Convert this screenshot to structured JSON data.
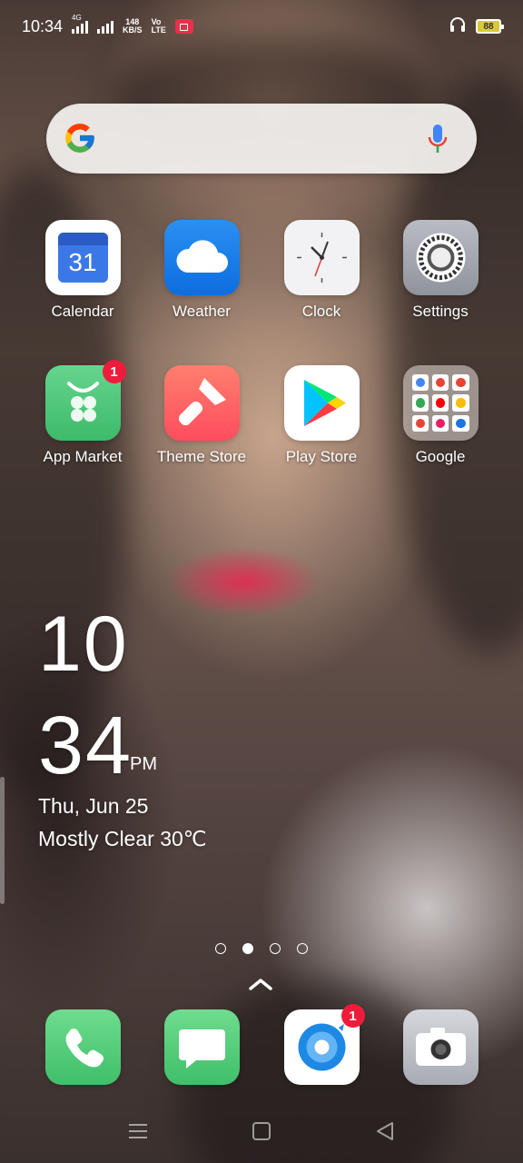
{
  "status_bar": {
    "time": "10:34",
    "network_1": "4G",
    "speed_value": "148",
    "speed_unit": "KB/S",
    "volte_top": "Vo",
    "volte_bottom": "LTE",
    "battery": "88"
  },
  "search_bar": {
    "logo": "google-g-icon",
    "mic": "mic-icon"
  },
  "apps": [
    {
      "label": "Calendar",
      "icon": "calendar-icon",
      "date_number": "31"
    },
    {
      "label": "Weather",
      "icon": "weather-cloud-icon"
    },
    {
      "label": "Clock",
      "icon": "clock-icon"
    },
    {
      "label": "Settings",
      "icon": "settings-gear-icon"
    },
    {
      "label": "App Market",
      "icon": "app-market-icon",
      "badge": "1"
    },
    {
      "label": "Theme Store",
      "icon": "paintbrush-icon"
    },
    {
      "label": "Play Store",
      "icon": "play-store-icon"
    },
    {
      "label": "Google",
      "icon": "folder-icon"
    }
  ],
  "clock_widget": {
    "hour": "10",
    "minute": "34",
    "ampm": "PM",
    "date": "Thu, Jun 25",
    "weather": "Mostly Clear 30℃"
  },
  "page_indicator": {
    "pages": 4,
    "active_index": 1
  },
  "dock": [
    {
      "icon": "phone-icon"
    },
    {
      "icon": "messages-icon"
    },
    {
      "icon": "browser-icon",
      "badge": "1"
    },
    {
      "icon": "camera-icon"
    }
  ],
  "nav_bar": {
    "menu": "menu-icon",
    "home": "home-icon",
    "back": "back-icon"
  }
}
